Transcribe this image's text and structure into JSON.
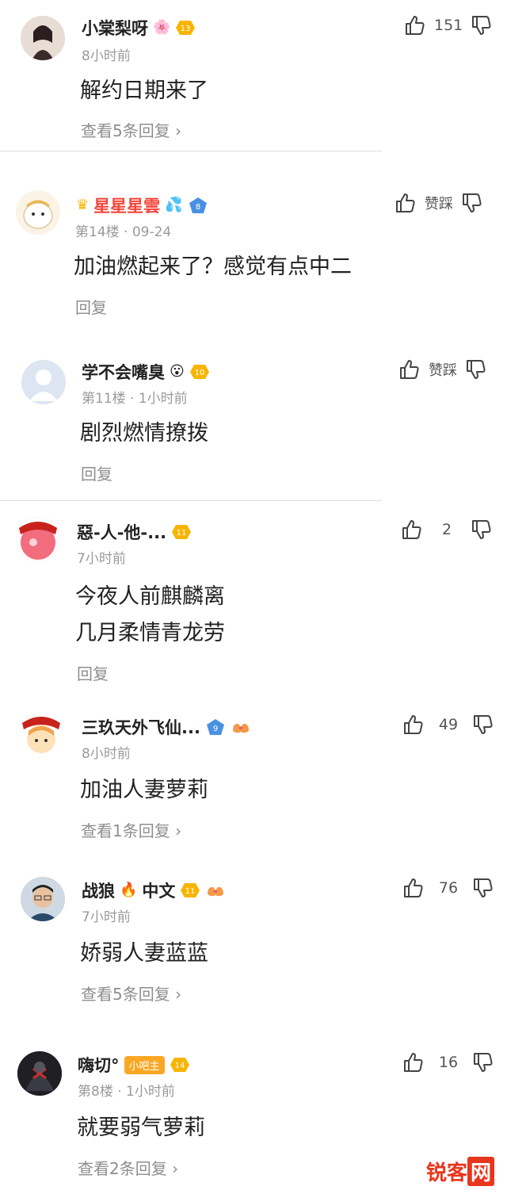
{
  "comments": [
    {
      "username": "小棠梨呀",
      "emoji": "🌸",
      "level": "13",
      "meta": "8小时前",
      "text": "解约日期来了",
      "reply": "查看5条回复 ›",
      "likes": "151"
    },
    {
      "username": "星星星雲",
      "emoji": "💦",
      "level": "8",
      "meta": "第14楼 · 09-24",
      "text": "加油燃起来了？感觉有点中二",
      "reply": "回复",
      "likes": "赞踩"
    },
    {
      "username": "学不会嘴臭",
      "emoji": "😮",
      "level": "10",
      "meta": "第11楼 · 1小时前",
      "text": "剧烈燃情撩拨",
      "reply": "回复",
      "likes": "赞踩"
    },
    {
      "username": "惡-人-他-...",
      "level": "11",
      "meta": "7小时前",
      "text_lines": [
        "今夜人前麒麟离",
        "几月柔情青龙劳"
      ],
      "reply": "回复",
      "likes": "2"
    },
    {
      "username": "三玖天外飞仙...",
      "level": "9",
      "meta": "8小时前",
      "text": "加油人妻萝莉",
      "reply": "查看1条回复 ›",
      "likes": "49"
    },
    {
      "username": "战狼",
      "emoji": "🔥",
      "username_suffix": "中文",
      "level": "11",
      "meta": "7小时前",
      "text": "娇弱人妻蓝蓝",
      "reply": "查看5条回复 ›",
      "likes": "76"
    },
    {
      "username": "嗨切°",
      "role": "小吧主",
      "level": "14",
      "meta": "第8楼 · 1小时前",
      "text": "就要弱气萝莉",
      "reply": "查看2条回复 ›",
      "likes": "16"
    }
  ],
  "watermark": {
    "part1": "锐客",
    "part2": "网"
  },
  "colors": {
    "vip_name": "#f2473b",
    "badge_gold": "#f7b500",
    "badge_blue": "#4a90e2",
    "role_badge": "#f9a825",
    "watermark": "#e8361e"
  },
  "icons": {
    "like": "thumbs-up-outline-icon",
    "dislike": "thumbs-down-outline-icon",
    "level": "level-badge-icon",
    "crown": "crown-icon"
  }
}
